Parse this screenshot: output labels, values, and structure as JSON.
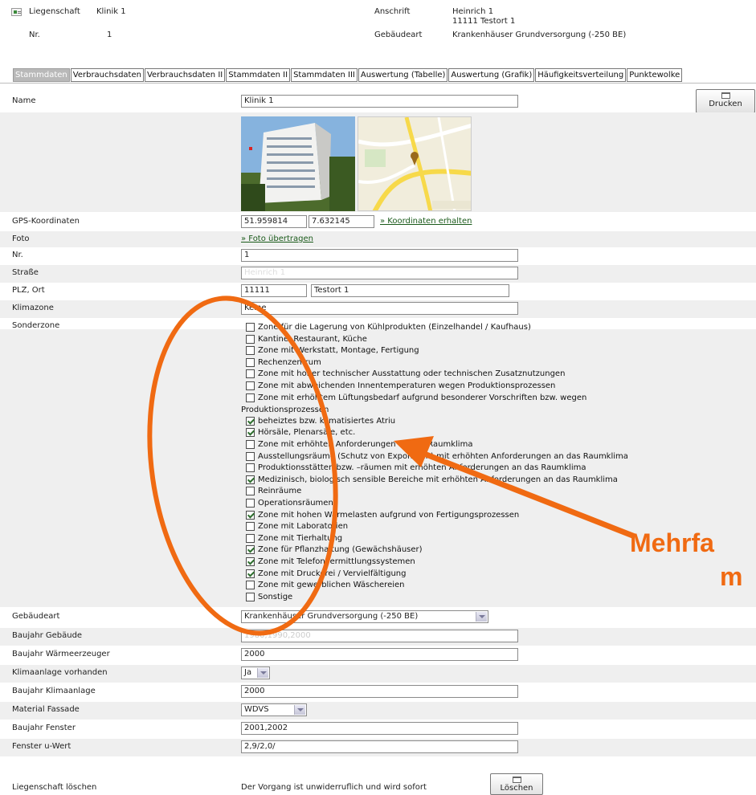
{
  "header": {
    "liegenschaft_label": "Liegenschaft",
    "liegenschaft_value": "Klinik 1",
    "nr_label": "Nr.",
    "nr_value": "1",
    "anschrift_label": "Anschrift",
    "anschrift_line1": "Heinrich 1",
    "anschrift_line2": "11111 Testort 1",
    "gebaeudeart_label": "Gebäudeart",
    "gebaeudeart_value": "Krankenhäuser Grundversorgung (-250 BE)"
  },
  "tabs": [
    {
      "label": "Stammdaten",
      "active": true
    },
    {
      "label": "Verbrauchsdaten"
    },
    {
      "label": "Verbrauchsdaten II"
    },
    {
      "label": "Stammdaten II"
    },
    {
      "label": "Stammdaten III"
    },
    {
      "label": "Auswertung (Tabelle)"
    },
    {
      "label": "Auswertung (Grafik)"
    },
    {
      "label": "Häufigkeitsverteilung"
    },
    {
      "label": "Punktewolke"
    }
  ],
  "buttons": {
    "print": "Drucken",
    "delete": "Löschen"
  },
  "fields": {
    "name_label": "Name",
    "name_value": "Klinik 1",
    "gps_label": "GPS-Koordinaten",
    "gps_lat": "51.959814",
    "gps_lon": "7.632145",
    "gps_link": "» Koordinaten erhalten",
    "foto_label": "Foto",
    "foto_link": "» Foto übertragen",
    "nr_label": "Nr.",
    "nr_value": "1",
    "strasse_label": "Straße",
    "strasse_value": "Heinrich 1",
    "plz_ort_label": "PLZ, Ort",
    "plz_value": "11111",
    "ort_value": "Testort 1",
    "klimazone_label": "Klimazone",
    "klimazone_value": "Keine",
    "sonderzone_label": "Sonderzone",
    "gebaeudeart_label": "Gebäudeart",
    "gebaeudeart_value": "Krankenhäuser Grundversorgung (-250 BE)",
    "baujahr_gebaeude_label": "Baujahr Gebäude",
    "baujahr_gebaeude_value": "1980,1990,2000",
    "baujahr_waerme_label": "Baujahr Wärmeerzeuger",
    "baujahr_waerme_value": "2000",
    "klimaanlage_label": "Klimaanlage vorhanden",
    "klimaanlage_value": "Ja",
    "baujahr_klima_label": "Baujahr Klimaanlage",
    "baujahr_klima_value": "2000",
    "material_label": "Material Fassade",
    "material_value": "WDVS",
    "baujahr_fenster_label": "Baujahr Fenster",
    "baujahr_fenster_value": "2001,2002",
    "fenster_uwert_label": "Fenster u-Wert",
    "fenster_uwert_value": "2,9/2,0/",
    "loeschen_label": "Liegenschaft löschen",
    "loeschen_text": "Der Vorgang ist unwiderruflich und wird sofort"
  },
  "sonderzonen": [
    {
      "label": "Zone für die Lagerung von Kühlprodukten (Einzelhandel / Kaufhaus)",
      "checked": false
    },
    {
      "label": "Kantine, Restaurant, Küche",
      "checked": false
    },
    {
      "label": "Zone mit Werkstatt, Montage, Fertigung",
      "checked": false
    },
    {
      "label": "Rechenzentrum",
      "checked": false
    },
    {
      "label": "Zone mit hoher technischer Ausstattung oder technischen Zusatznutzungen",
      "checked": false
    },
    {
      "label": "Zone mit abweichenden Innentemperaturen wegen Produktionsprozessen",
      "checked": false
    },
    {
      "label": "Zone mit erhöhtem Lüftungsbedarf aufgrund besonderer Vorschriften bzw. wegen",
      "checked": false
    },
    {
      "label": "beheiztes bzw. klimatisiertes Atriu",
      "checked": true
    },
    {
      "label": "Hörsäle, Plenarsäle, etc.",
      "checked": true
    },
    {
      "label": "Zone mit erhöhten Anforderungen an das Raumklima",
      "checked": false
    },
    {
      "label": "Ausstellungsräume (Schutz von Exponaten) mit erhöhten Anforderungen an das Raumklima",
      "checked": false
    },
    {
      "label": "Produktionsstätten bzw. –räumen mit erhöhten Anforderungen an das Raumklima",
      "checked": false
    },
    {
      "label": "Medizinisch, biologisch sensible Bereiche mit erhöhten Anforderungen an das Raumklima",
      "checked": true
    },
    {
      "label": "Reinräume",
      "checked": false
    },
    {
      "label": "Operationsräumen",
      "checked": false
    },
    {
      "label": "Zone mit hohen Wärmelasten aufgrund von Fertigungsprozessen",
      "checked": true
    },
    {
      "label": "Zone mit Laboratorien",
      "checked": false
    },
    {
      "label": "Zone mit Tierhaltung",
      "checked": false
    },
    {
      "label": "Zone für Pflanzhaltung (Gewächshäuser)",
      "checked": true
    },
    {
      "label": "Zone mit Telefonvermittlungssystemen",
      "checked": true
    },
    {
      "label": "Zone mit Druckerei / Vervielfältigung",
      "checked": true
    },
    {
      "label": "Zone mit gewerblichen Wäschereien",
      "checked": false
    },
    {
      "label": "Sonstige",
      "checked": false
    }
  ],
  "sonderzone_wrap_text": "Produktionsprozessen",
  "annotation": {
    "line1": "Mehrfa",
    "line2": "m",
    "color": "#f06a12"
  }
}
